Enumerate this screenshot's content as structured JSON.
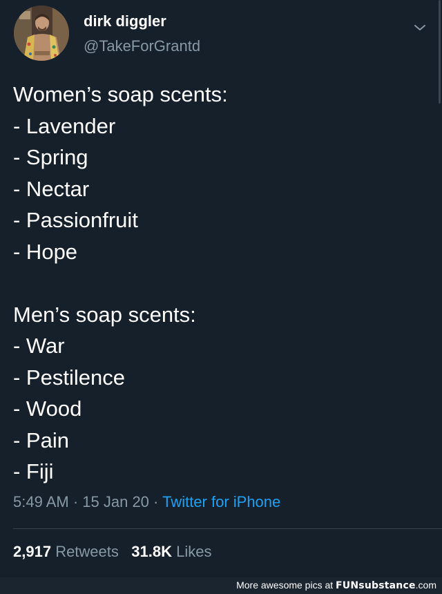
{
  "tweet": {
    "display_name": "dirk diggler",
    "handle": "@TakeForGrantd",
    "lines": [
      "Women’s soap scents:",
      "- Lavender",
      "- Spring",
      "- Nectar",
      "- Passionfruit",
      "- Hope",
      "",
      "Men’s soap scents:",
      "- War",
      "- Pestilence",
      "- Wood",
      "- Pain",
      "- Fiji"
    ],
    "time": "5:49 AM",
    "date": "15 Jan 20",
    "source": "Twitter for iPhone",
    "separator": " · ",
    "retweets_count": "2,917",
    "retweets_label": "Retweets",
    "likes_count": "31.8K",
    "likes_label": "Likes"
  },
  "footer": {
    "prefix": "More awesome pics at ",
    "brand": "FUNsubstance",
    "suffix": ".com"
  },
  "icons": {
    "avatar": "profile-photo",
    "caret": "chevron-down-icon"
  },
  "colors": {
    "background": "#16202b",
    "secondary_text": "#8899a6",
    "link": "#1da1f2",
    "divider": "#38444d"
  }
}
